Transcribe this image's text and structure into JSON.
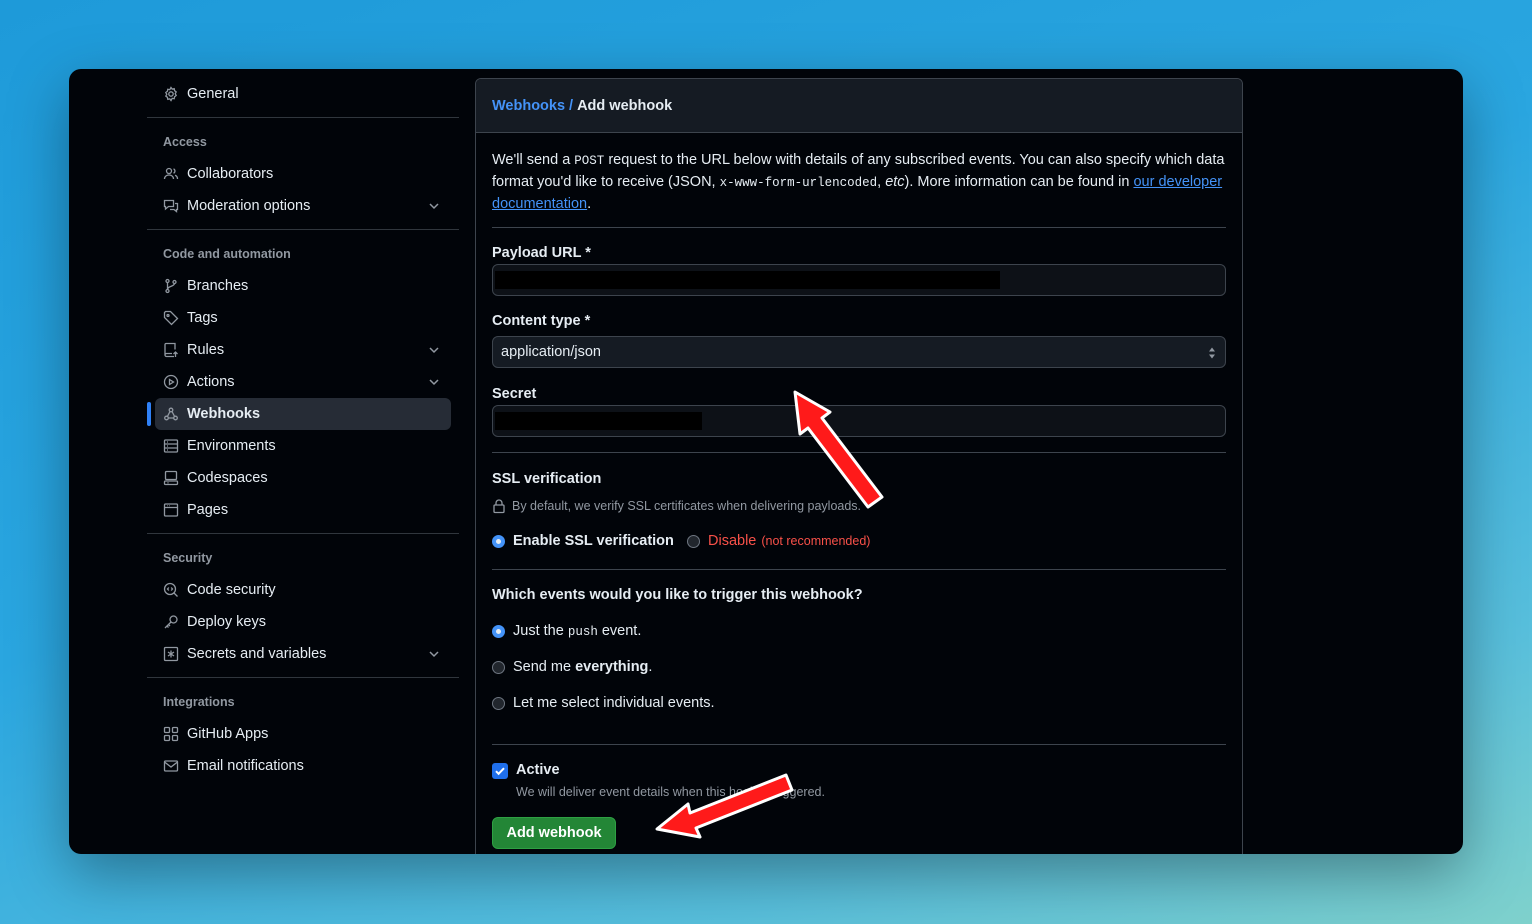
{
  "sidebar": {
    "general": "General",
    "sections": {
      "access": "Access",
      "code_automation": "Code and automation",
      "security": "Security",
      "integrations": "Integrations"
    },
    "items": {
      "collaborators": "Collaborators",
      "moderation": "Moderation options",
      "branches": "Branches",
      "tags": "Tags",
      "rules": "Rules",
      "actions": "Actions",
      "webhooks": "Webhooks",
      "environments": "Environments",
      "codespaces": "Codespaces",
      "pages": "Pages",
      "code_security": "Code security",
      "deploy_keys": "Deploy keys",
      "secrets_variables": "Secrets and variables",
      "github_apps": "GitHub Apps",
      "email_notifications": "Email notifications"
    }
  },
  "header": {
    "crumb_link": "Webhooks",
    "crumb_sep": "/",
    "crumb_current": "Add webhook"
  },
  "intro": {
    "p1": "We'll send a ",
    "post": "POST",
    "p2": " request to the URL below with details of any subscribed events. You can also specify which data format you'd like to receive (JSON, ",
    "urlencoded": "x-www-form-urlencoded",
    "p3": ", ",
    "etc": "etc",
    "p4": "). More information can be found in ",
    "link": "our developer documentation",
    "p5": "."
  },
  "form": {
    "payload_label": "Payload URL *",
    "content_type_label": "Content type *",
    "content_type_value": "application/json",
    "secret_label": "Secret",
    "ssl_title": "SSL verification",
    "ssl_note": "By default, we verify SSL certificates when delivering payloads.",
    "ssl_enable": "Enable SSL verification",
    "ssl_disable": "Disable",
    "ssl_disable_note": "(not recommended)",
    "events_title": "Which events would you like to trigger this webhook?",
    "event_push_a": "Just the ",
    "event_push_code": "push",
    "event_push_b": " event.",
    "event_all_a": "Send me ",
    "event_all_b": "everything",
    "event_all_c": ".",
    "event_select": "Let me select individual events.",
    "active_label": "Active",
    "active_note": "We will deliver event details when this hook is triggered.",
    "submit": "Add webhook"
  },
  "colors": {
    "accent": "#4493f8",
    "button": "#238636",
    "danger": "#f85149",
    "annotation_arrow": "#ff1a1a"
  }
}
